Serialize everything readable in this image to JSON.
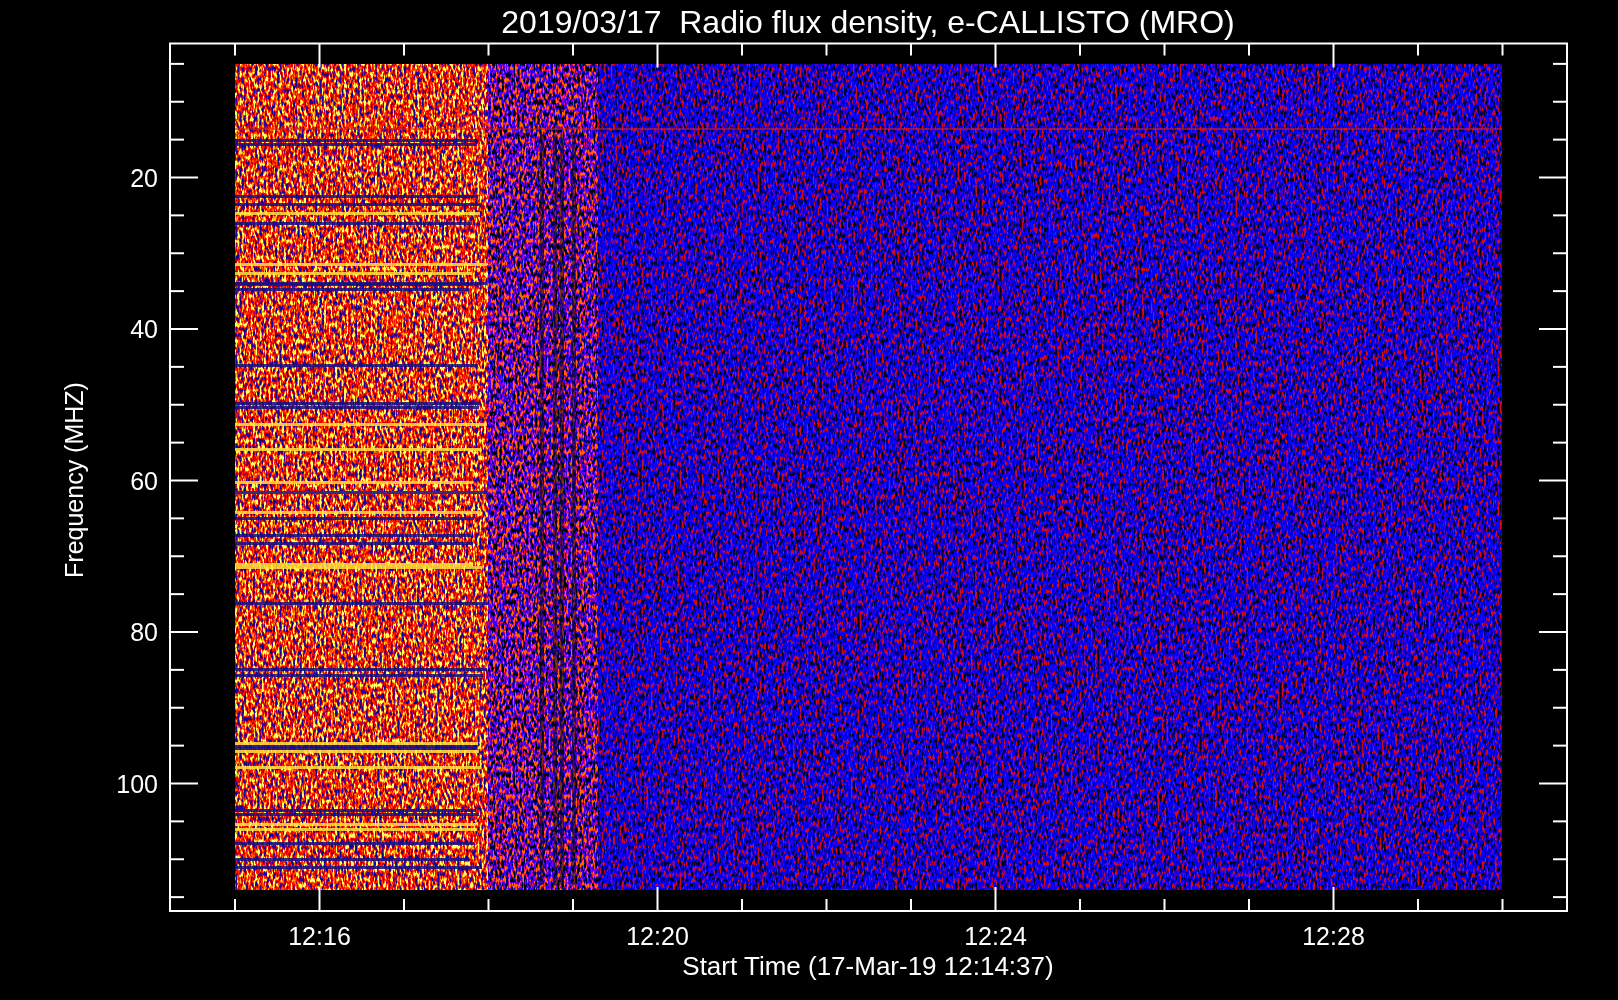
{
  "plot": {
    "title": "2019/03/17  Radio flux density, e-CALLISTO (MRO)",
    "ylabel": "Frequency (MHZ)",
    "xlabel": "Start Time (17-Mar-19 12:14:37)",
    "yticks": [
      "20",
      "40",
      "60",
      "80",
      "100"
    ],
    "xticks": [
      "12:16",
      "12:20",
      "12:24",
      "12:28"
    ]
  }
}
